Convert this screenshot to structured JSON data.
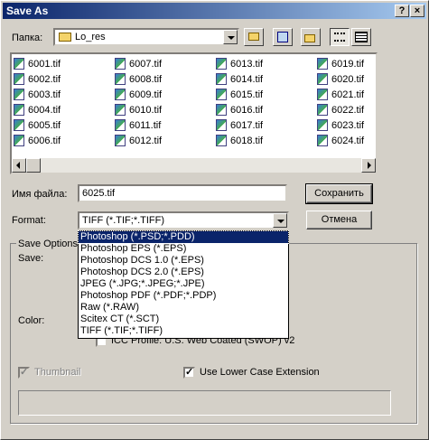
{
  "window": {
    "title": "Save As",
    "help_btn": "?",
    "close_btn": "×"
  },
  "location": {
    "label": "Папка:",
    "value": "Lo_res"
  },
  "files": {
    "col1": [
      "6001.tif",
      "6002.tif",
      "6003.tif",
      "6004.tif",
      "6005.tif",
      "6006.tif"
    ],
    "col2": [
      "6007.tif",
      "6008.tif",
      "6009.tif",
      "6010.tif",
      "6011.tif",
      "6012.tif"
    ],
    "col3": [
      "6013.tif",
      "6014.tif",
      "6015.tif",
      "6016.tif",
      "6017.tif",
      "6018.tif"
    ],
    "col4": [
      "6019.tif",
      "6020.tif",
      "6021.tif",
      "6022.tif",
      "6023.tif",
      "6024.tif"
    ]
  },
  "filename": {
    "label": "Имя файла:",
    "value": "6025.tif"
  },
  "format": {
    "label": "Format:",
    "value": "TIFF (*.TIF;*.TIFF)",
    "options": [
      "Photoshop (*.PSD;*.PDD)",
      "Photoshop EPS (*.EPS)",
      "Photoshop DCS 1.0 (*.EPS)",
      "Photoshop DCS 2.0 (*.EPS)",
      "JPEG (*.JPG;*.JPEG;*.JPE)",
      "Photoshop PDF (*.PDF;*.PDP)",
      "Raw (*.RAW)",
      "Scitex CT (*.SCT)",
      "TIFF (*.TIF;*.TIFF)"
    ]
  },
  "buttons": {
    "save": "Сохранить",
    "cancel": "Отмена"
  },
  "options": {
    "group_label": "Save Options",
    "save_label": "Save:",
    "color_label": "Color:",
    "icc_label": "ICC Profile:  U.S. Web Coated (SWOP) v2",
    "thumbnail_label": "Thumbnail",
    "lowercase_label": "Use Lower Case Extension"
  }
}
